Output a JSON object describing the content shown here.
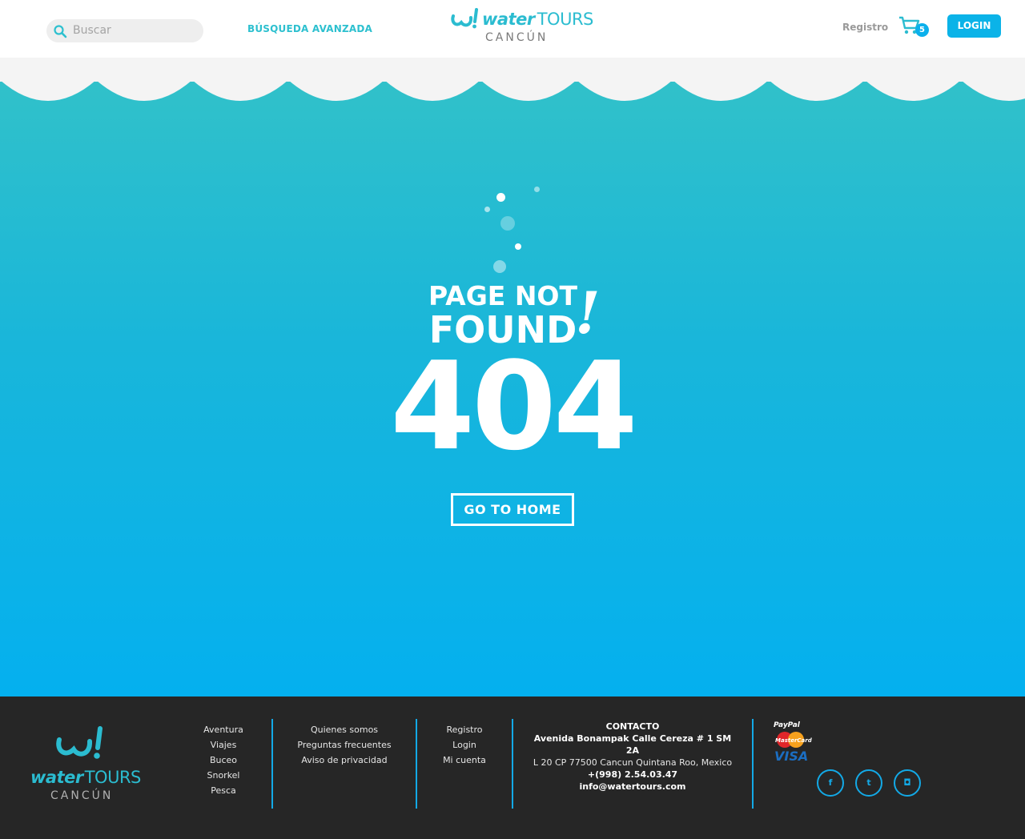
{
  "header": {
    "search_placeholder": "Buscar",
    "advanced_search": "BÚSQUEDA AVANZADA",
    "logo_brand_bold": "water",
    "logo_brand_light": "TOURS",
    "logo_city": "CANCÚN",
    "register_label": "Registro",
    "cart_count": "5",
    "login_label": "LOGIN"
  },
  "main": {
    "title_line1": "PAGE NOT",
    "title_line2": "FOUND",
    "exclamation": "!",
    "error_code": "404",
    "home_button": "GO TO HOME"
  },
  "footer": {
    "logo_brand_bold": "water",
    "logo_brand_light": "TOURS",
    "logo_city": "CANCÚN",
    "col1": [
      "Aventura",
      "Viajes",
      "Buceo",
      "Snorkel",
      "Pesca"
    ],
    "col2": [
      "Quienes somos",
      "Preguntas frecuentes",
      "Aviso de privacidad"
    ],
    "col3": [
      "Registro",
      "Login",
      "Mi cuenta"
    ],
    "contact": {
      "heading": "CONTACTO",
      "address1": "Avenida Bonampak Calle Cereza # 1 SM 2A",
      "address2": "L 20 CP 77500 Cancun Quintana Roo, Mexico",
      "phone": "+(998) 2.54.03.47",
      "email": "info@watertours.com"
    },
    "payments": {
      "paypal": "PayPal",
      "mastercard": "MasterCard",
      "visa": "VISA"
    },
    "social": [
      {
        "icon": "facebook-icon",
        "glyph": "f"
      },
      {
        "icon": "twitter-icon",
        "glyph": "t"
      },
      {
        "icon": "instagram-icon",
        "glyph": "◘"
      }
    ]
  },
  "colors": {
    "accent": "#2dc0cf",
    "button": "#0bb3e8",
    "water_top": "#33c2c8",
    "water_bottom": "#04b0ef",
    "footer_bg": "#262626",
    "divider": "#13a9e6"
  }
}
